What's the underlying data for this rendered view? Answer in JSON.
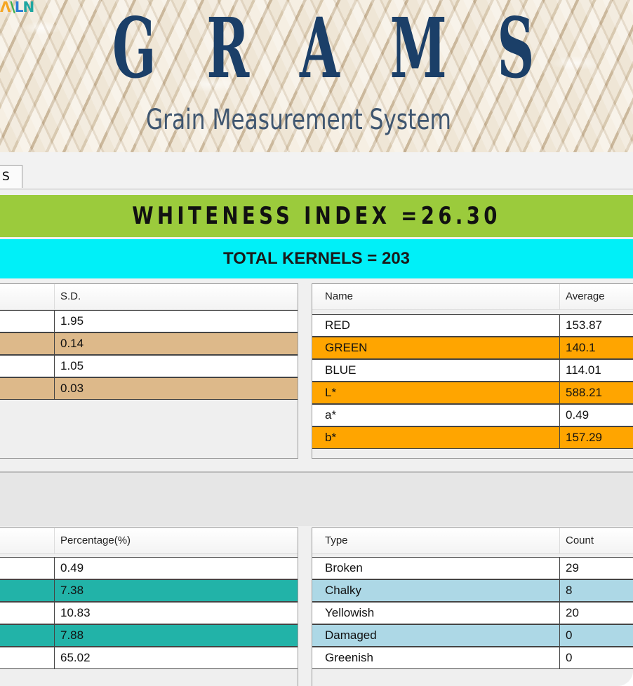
{
  "banner": {
    "logo_letters": [
      "Λ",
      "\\",
      "L",
      "N"
    ],
    "title_letters": [
      "G",
      "R",
      "A",
      "M",
      "S"
    ],
    "subtitle": "Grain Measurement System"
  },
  "tab": {
    "label": "S"
  },
  "whiteness": {
    "text": "WHITENESS INDEX =26.30"
  },
  "kernels": {
    "text": "TOTAL KERNELS = 203"
  },
  "size_table": {
    "header": "S.D.",
    "rows": [
      {
        "value": "1.95",
        "color": "#ffffff"
      },
      {
        "value": "0.14",
        "color": "#ddb98a"
      },
      {
        "value": "1.05",
        "color": "#ffffff"
      },
      {
        "value": "0.03",
        "color": "#ddb98a"
      }
    ]
  },
  "color_table": {
    "headers": [
      "Name",
      "Average"
    ],
    "rows": [
      {
        "name": "RED",
        "average": "153.87",
        "color": "#ffffff"
      },
      {
        "name": "GREEN",
        "average": "140.1",
        "color": "#ffa500"
      },
      {
        "name": "BLUE",
        "average": "114.01",
        "color": "#ffffff"
      },
      {
        "name": "L*",
        "average": "588.21",
        "color": "#ffa500"
      },
      {
        "name": "a*",
        "average": "0.49",
        "color": "#ffffff"
      },
      {
        "name": "b*",
        "average": "157.29",
        "color": "#ffa500"
      }
    ]
  },
  "percent_table": {
    "header": "Percentage(%)",
    "rows": [
      {
        "value": "0.49",
        "color": "#ffffff"
      },
      {
        "value": "7.38",
        "color": "#22b3a8"
      },
      {
        "value": "10.83",
        "color": "#ffffff"
      },
      {
        "value": "7.88",
        "color": "#22b3a8"
      },
      {
        "value": "65.02",
        "color": "#ffffff"
      }
    ]
  },
  "type_table": {
    "headers": [
      "Type",
      "Count"
    ],
    "rows": [
      {
        "type": "Broken",
        "count": "29",
        "color": "#ffffff"
      },
      {
        "type": "Chalky",
        "count": "8",
        "color": "#add8e6"
      },
      {
        "type": "Yellowish",
        "count": "20",
        "color": "#ffffff"
      },
      {
        "type": "Damaged",
        "count": "0",
        "color": "#add8e6"
      },
      {
        "type": "Greenish",
        "count": "0",
        "color": "#ffffff"
      }
    ]
  }
}
